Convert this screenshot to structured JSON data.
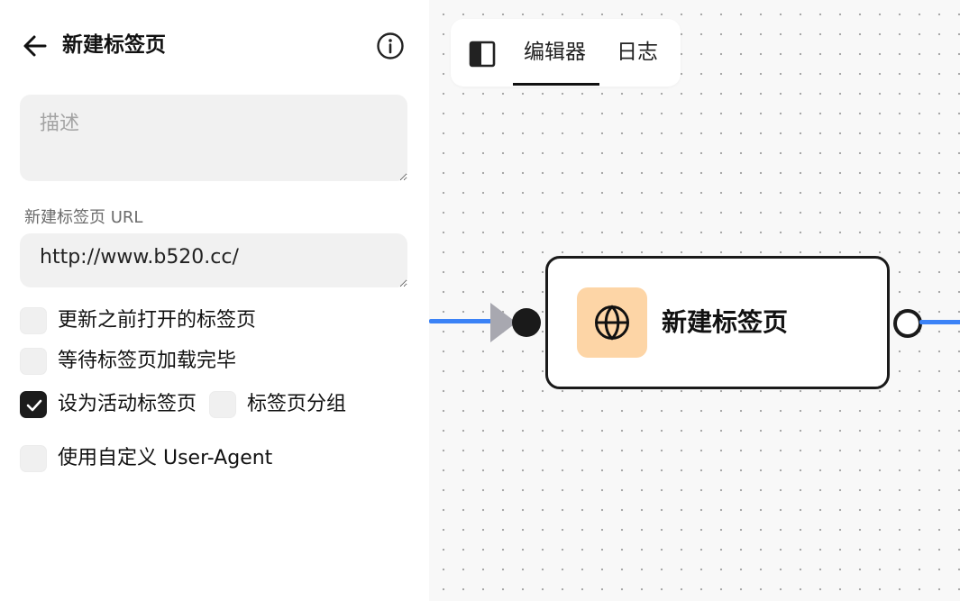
{
  "panel": {
    "title": "新建标签页",
    "back_icon": "arrow-left-icon",
    "info_icon": "info-circle-icon",
    "description": {
      "placeholder": "描述",
      "value": ""
    },
    "url_field": {
      "label": "新建标签页 URL",
      "value": "http://www.b520.cc/"
    },
    "options": [
      {
        "label": "更新之前打开的标签页",
        "checked": false
      },
      {
        "label": "等待标签页加载完毕",
        "checked": false
      },
      {
        "label": "设为活动标签页",
        "checked": true
      },
      {
        "label": "标签页分组",
        "checked": false
      },
      {
        "label": "使用自定义 User-Agent",
        "checked": false
      }
    ]
  },
  "canvas": {
    "toolbar": {
      "sidebar_icon": "sidebar-toggle-icon",
      "tabs": [
        {
          "label": "编辑器",
          "active": true
        },
        {
          "label": "日志",
          "active": false
        }
      ]
    },
    "node": {
      "title": "新建标签页",
      "icon": "globe-icon"
    },
    "colors": {
      "edge": "#3b82f6",
      "node_icon_bg": "#fdd5a6",
      "arrow": "#a8a8b0"
    }
  }
}
